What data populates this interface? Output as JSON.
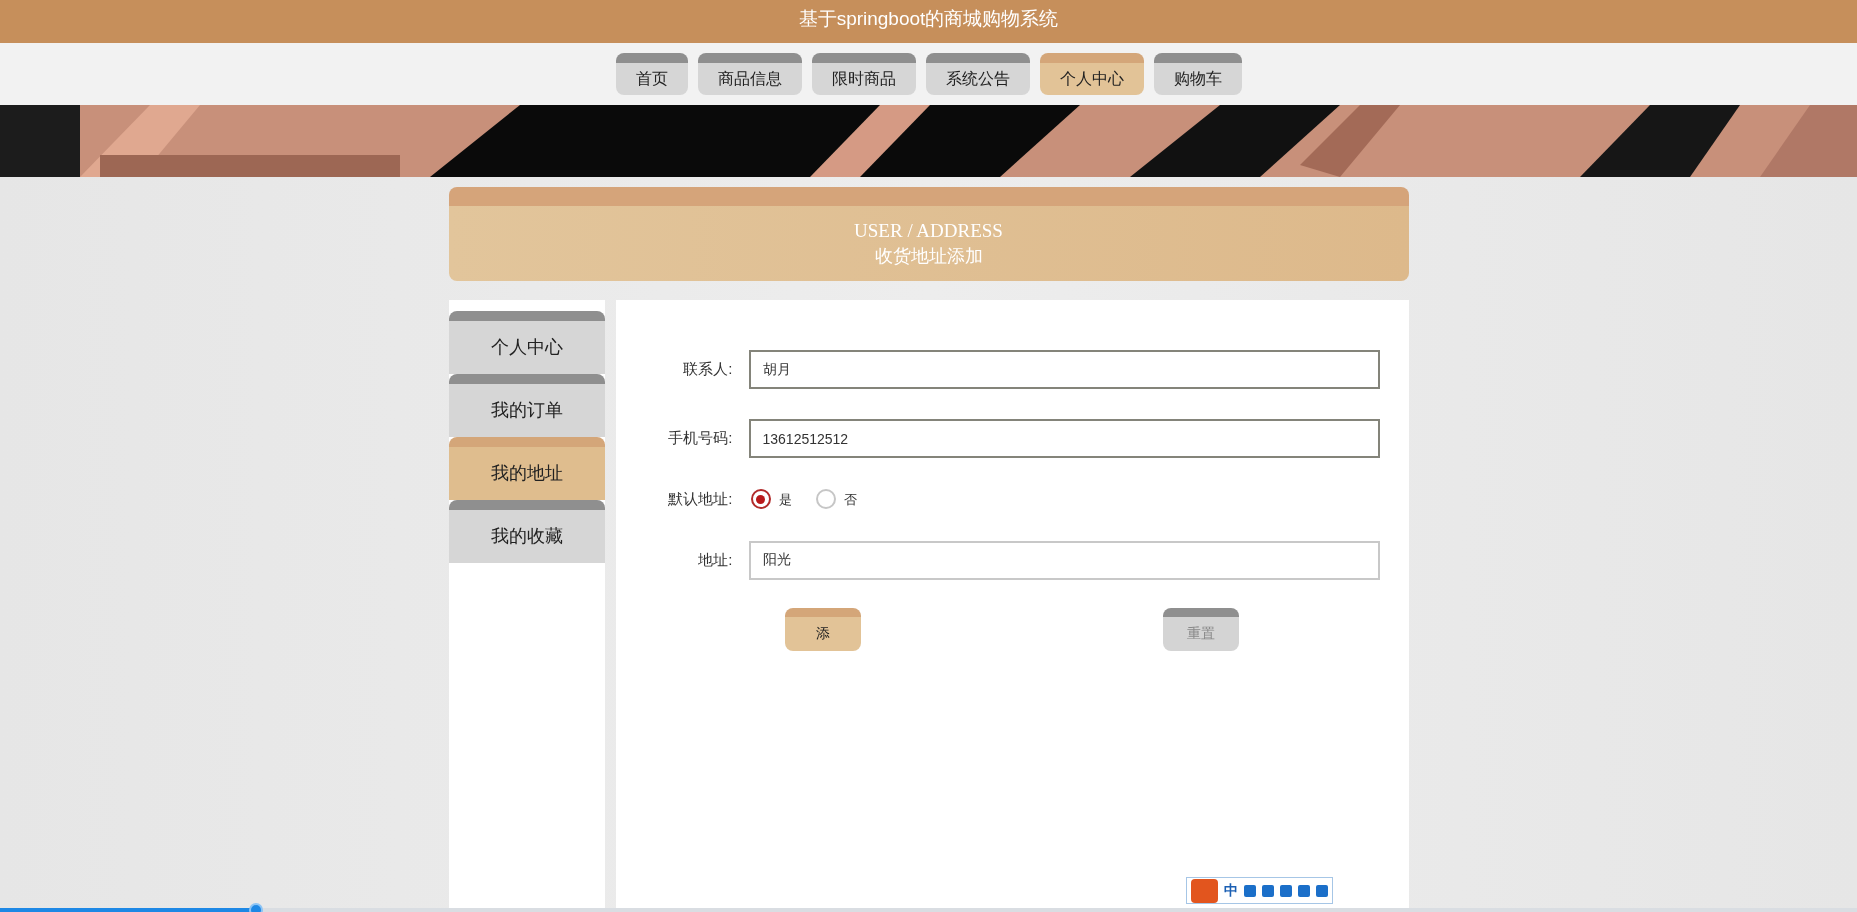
{
  "header": {
    "title": "基于springboot的商城购物系统"
  },
  "nav": [
    {
      "label": "首页",
      "selected": false
    },
    {
      "label": "商品信息",
      "selected": false
    },
    {
      "label": "限时商品",
      "selected": false
    },
    {
      "label": "系统公告",
      "selected": false
    },
    {
      "label": "个人中心",
      "selected": true
    },
    {
      "label": "购物车",
      "selected": false
    }
  ],
  "page_title": {
    "subtitle": "USER / ADDRESS",
    "title": "收货地址添加"
  },
  "sidebar": [
    {
      "label": "个人中心",
      "selected": false
    },
    {
      "label": "我的订单",
      "selected": false
    },
    {
      "label": "我的地址",
      "selected": true
    },
    {
      "label": "我的收藏",
      "selected": false
    }
  ],
  "form": {
    "fields": [
      {
        "kind": "text",
        "label": "联系人:",
        "value": "胡月",
        "focused": false
      },
      {
        "kind": "text",
        "label": "手机号码:",
        "value": "13612512512",
        "focused": false
      },
      {
        "kind": "radio",
        "label": "默认地址:",
        "options": [
          {
            "label": "是",
            "selected": true
          },
          {
            "label": "否",
            "selected": false
          }
        ]
      },
      {
        "kind": "text",
        "label": "地址:",
        "value": "阳光",
        "focused": true
      }
    ],
    "buttons": [
      {
        "label": "添",
        "kind": "primary"
      },
      {
        "label": "重置",
        "kind": "secondary"
      }
    ]
  },
  "ime_toolbar": {
    "mode": "中"
  },
  "video_progress": {
    "level": 0.138
  }
}
